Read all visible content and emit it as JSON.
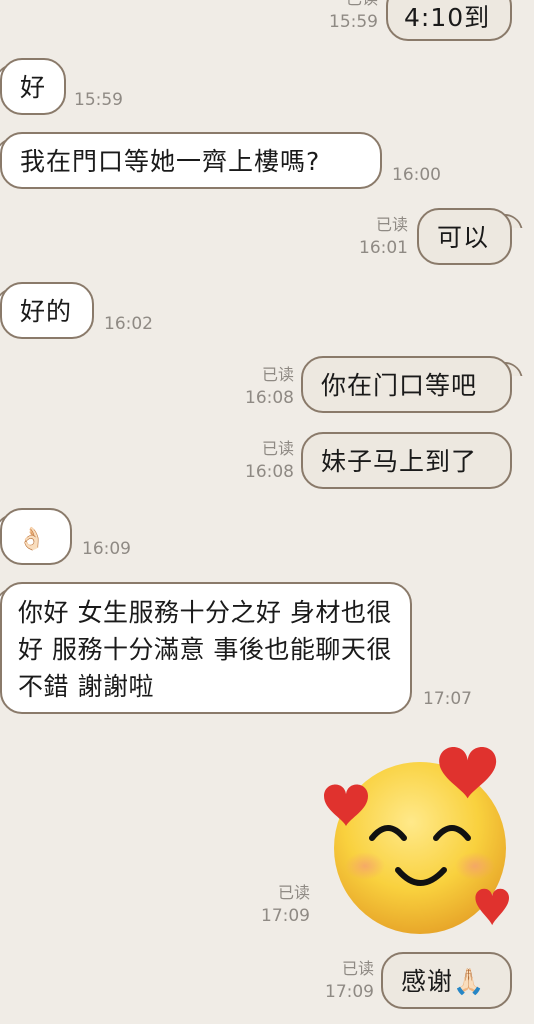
{
  "messages": [
    {
      "text": "4:10到",
      "dir": "out",
      "read": "已读",
      "time": "15:59"
    },
    {
      "text": "好",
      "dir": "in",
      "time": "15:59"
    },
    {
      "text": "我在門口等她一齊上樓嗎?",
      "dir": "in",
      "time": "16:00"
    },
    {
      "text": "可以",
      "dir": "out",
      "read": "已读",
      "time": "16:01"
    },
    {
      "text": "好的",
      "dir": "in",
      "time": "16:02"
    },
    {
      "text": "你在门口等吧",
      "dir": "out",
      "read": "已读",
      "time": "16:08"
    },
    {
      "text": "妹子马上到了",
      "dir": "out",
      "read": "已读",
      "time": "16:08"
    },
    {
      "text": "👌🏻",
      "dir": "in",
      "time": "16:09"
    },
    {
      "text": "你好 女生服務十分之好 身材也很好 服務十分滿意 事後也能聊天很不錯 謝謝啦",
      "dir": "in",
      "time": "17:07"
    },
    {
      "sticker": "smiling-face-with-hearts",
      "dir": "out",
      "read": "已读",
      "time": "17:09"
    },
    {
      "text": "感谢🙏🏻",
      "dir": "out",
      "read": "已读",
      "time": "17:09"
    }
  ],
  "colors": {
    "background": "#f0ece6",
    "bubble_border": "#8a7a6a",
    "incoming": "#ffffff",
    "outgoing": "#ede8e0",
    "meta_text": "#8f8a84"
  }
}
